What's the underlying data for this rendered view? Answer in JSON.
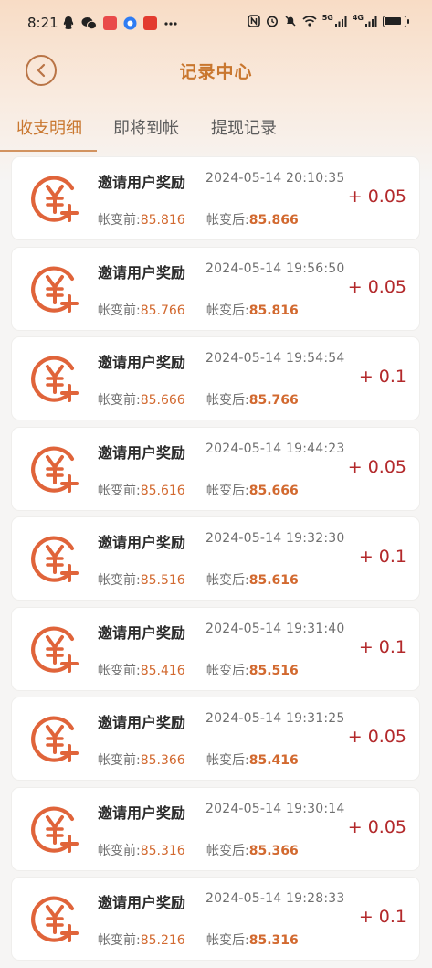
{
  "status_bar": {
    "time": "8:21",
    "network_5g": "5G",
    "network_4g": "4G"
  },
  "header": {
    "title": "记录中心"
  },
  "tabs": [
    {
      "label": "收支明细",
      "active": true
    },
    {
      "label": "即将到帐",
      "active": false
    },
    {
      "label": "提现记录",
      "active": false
    }
  ],
  "labels": {
    "before": "帐变前:",
    "after": "帐变后:"
  },
  "records": [
    {
      "title": "邀请用户奖励",
      "time": "2024-05-14 20:10:35",
      "before": "85.816",
      "after": "85.866",
      "amount": "+ 0.05"
    },
    {
      "title": "邀请用户奖励",
      "time": "2024-05-14 19:56:50",
      "before": "85.766",
      "after": "85.816",
      "amount": "+ 0.05"
    },
    {
      "title": "邀请用户奖励",
      "time": "2024-05-14 19:54:54",
      "before": "85.666",
      "after": "85.766",
      "amount": "+ 0.1"
    },
    {
      "title": "邀请用户奖励",
      "time": "2024-05-14 19:44:23",
      "before": "85.616",
      "after": "85.666",
      "amount": "+ 0.05"
    },
    {
      "title": "邀请用户奖励",
      "time": "2024-05-14 19:32:30",
      "before": "85.516",
      "after": "85.616",
      "amount": "+ 0.1"
    },
    {
      "title": "邀请用户奖励",
      "time": "2024-05-14 19:31:40",
      "before": "85.416",
      "after": "85.516",
      "amount": "+ 0.1"
    },
    {
      "title": "邀请用户奖励",
      "time": "2024-05-14 19:31:25",
      "before": "85.366",
      "after": "85.416",
      "amount": "+ 0.05"
    },
    {
      "title": "邀请用户奖励",
      "time": "2024-05-14 19:30:14",
      "before": "85.316",
      "after": "85.366",
      "amount": "+ 0.05"
    },
    {
      "title": "邀请用户奖励",
      "time": "2024-05-14 19:28:33",
      "before": "85.216",
      "after": "85.316",
      "amount": "+ 0.1"
    }
  ],
  "colors": {
    "accent": "#c9772f",
    "icon": "#e0643a",
    "amount": "#b3292b"
  },
  "icons": {
    "back": "chevron-left-icon",
    "record": "yuan-plus-icon"
  }
}
